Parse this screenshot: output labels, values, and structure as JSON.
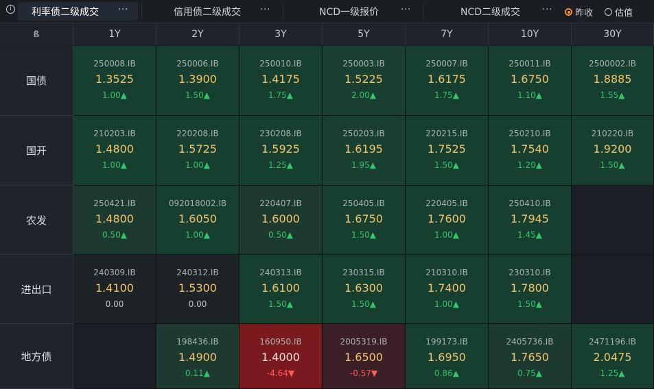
{
  "tabs": [
    {
      "label": "利率债二级成交",
      "more": "···",
      "active": true
    },
    {
      "label": "信用债二级成交",
      "more": "···",
      "active": false
    },
    {
      "label": "NCD一级报价",
      "more": "···",
      "active": false
    },
    {
      "label": "NCD二级成交",
      "more": "···",
      "active": false
    }
  ],
  "radios": [
    {
      "label": "昨收",
      "checked": true
    },
    {
      "label": "估值",
      "checked": false
    }
  ],
  "corner_label": "ß",
  "tenors": [
    "1Y",
    "2Y",
    "3Y",
    "5Y",
    "7Y",
    "10Y",
    "30Y"
  ],
  "rows": [
    {
      "label": "国债",
      "cells": [
        {
          "code": "250008.IB",
          "yield": "1.3525",
          "chg": "1.00▲",
          "dir": "up",
          "bg": "#173f30"
        },
        {
          "code": "250006.IB",
          "yield": "1.3900",
          "chg": "1.50▲",
          "dir": "up",
          "bg": "#173f30"
        },
        {
          "code": "250010.IB",
          "yield": "1.4175",
          "chg": "1.75▲",
          "dir": "up",
          "bg": "#173f30"
        },
        {
          "code": "250003.IB",
          "yield": "1.5225",
          "chg": "2.00▲",
          "dir": "up",
          "bg": "#183f30"
        },
        {
          "code": "250007.IB",
          "yield": "1.6175",
          "chg": "1.75▲",
          "dir": "up",
          "bg": "#173f30"
        },
        {
          "code": "250011.IB",
          "yield": "1.6750",
          "chg": "1.10▲",
          "dir": "up",
          "bg": "#173f30"
        },
        {
          "code": "2500002.IB",
          "yield": "1.8885",
          "chg": "1.55▲",
          "dir": "up",
          "bg": "#173f30"
        }
      ]
    },
    {
      "label": "国开",
      "cells": [
        {
          "code": "210203.IB",
          "yield": "1.4800",
          "chg": "1.00▲",
          "dir": "up",
          "bg": "#173f30"
        },
        {
          "code": "220208.IB",
          "yield": "1.5725",
          "chg": "1.00▲",
          "dir": "up",
          "bg": "#173f30"
        },
        {
          "code": "230208.IB",
          "yield": "1.5925",
          "chg": "1.25▲",
          "dir": "up",
          "bg": "#173f30"
        },
        {
          "code": "250203.IB",
          "yield": "1.6195",
          "chg": "1.95▲",
          "dir": "up",
          "bg": "#183f30"
        },
        {
          "code": "220215.IB",
          "yield": "1.7525",
          "chg": "1.50▲",
          "dir": "up",
          "bg": "#173f30"
        },
        {
          "code": "250210.IB",
          "yield": "1.7540",
          "chg": "1.20▲",
          "dir": "up",
          "bg": "#173f30"
        },
        {
          "code": "210220.IB",
          "yield": "1.9200",
          "chg": "1.50▲",
          "dir": "up",
          "bg": "#173f30"
        }
      ]
    },
    {
      "label": "农发",
      "cells": [
        {
          "code": "250421.IB",
          "yield": "1.4800",
          "chg": "0.50▲",
          "dir": "up",
          "bg": "#1c3a2f"
        },
        {
          "code": "092018002.IB",
          "yield": "1.6050",
          "chg": "1.00▲",
          "dir": "up",
          "bg": "#173f30"
        },
        {
          "code": "220407.IB",
          "yield": "1.6000",
          "chg": "0.50▲",
          "dir": "up",
          "bg": "#1c3a2f"
        },
        {
          "code": "250405.IB",
          "yield": "1.6750",
          "chg": "1.50▲",
          "dir": "up",
          "bg": "#173f30"
        },
        {
          "code": "220405.IB",
          "yield": "1.7600",
          "chg": "1.00▲",
          "dir": "up",
          "bg": "#173f30"
        },
        {
          "code": "250410.IB",
          "yield": "1.7945",
          "chg": "1.45▲",
          "dir": "up",
          "bg": "#173f30"
        },
        null
      ]
    },
    {
      "label": "进出口",
      "cells": [
        {
          "code": "240309.IB",
          "yield": "1.4100",
          "chg": "0.00",
          "dir": "flat",
          "bg": "#1e2328"
        },
        {
          "code": "240312.IB",
          "yield": "1.5300",
          "chg": "0.00",
          "dir": "flat",
          "bg": "#1e2328"
        },
        {
          "code": "240313.IB",
          "yield": "1.6100",
          "chg": "1.50▲",
          "dir": "up",
          "bg": "#173f30"
        },
        {
          "code": "230315.IB",
          "yield": "1.6300",
          "chg": "1.50▲",
          "dir": "up",
          "bg": "#173f30"
        },
        {
          "code": "210310.IB",
          "yield": "1.7400",
          "chg": "1.00▲",
          "dir": "up",
          "bg": "#173f30"
        },
        {
          "code": "230310.IB",
          "yield": "1.7800",
          "chg": "1.50▲",
          "dir": "up",
          "bg": "#173f30"
        },
        null
      ]
    },
    {
      "label": "地方债",
      "cells": [
        null,
        {
          "code": "198436.IB",
          "yield": "1.4900",
          "chg": "0.11▲",
          "dir": "up",
          "bg": "#1c3a2f"
        },
        {
          "code": "160950.IB",
          "yield": "1.4000",
          "chg": "-4.64▼",
          "dir": "down",
          "bg": "#7a1a1f"
        },
        {
          "code": "2005319.IB",
          "yield": "1.6500",
          "chg": "-0.57▼",
          "dir": "down",
          "bg": "#3a2026"
        },
        {
          "code": "199173.IB",
          "yield": "1.6950",
          "chg": "0.86▲",
          "dir": "up",
          "bg": "#173f30"
        },
        {
          "code": "2405736.IB",
          "yield": "1.7650",
          "chg": "0.75▲",
          "dir": "up",
          "bg": "#1c3a2f"
        },
        {
          "code": "2471196.IB",
          "yield": "2.0475",
          "chg": "1.25▲",
          "dir": "up",
          "bg": "#173f30"
        }
      ]
    }
  ]
}
